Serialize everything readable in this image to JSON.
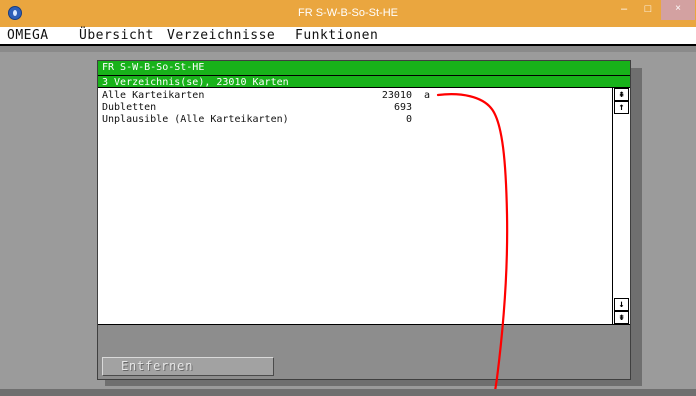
{
  "window": {
    "title": "FR S-W-B-So-St-HE",
    "icon": "app-icon",
    "controls": {
      "minimize": "–",
      "maximize": "□",
      "close": "×"
    },
    "colors": {
      "titlebar": "#eaa63f",
      "close": "#d3a1a1"
    }
  },
  "menu": {
    "items": [
      "OMEGA",
      "Übersicht",
      "Verzeichnisse",
      "Funktionen"
    ]
  },
  "dialog": {
    "title": "FR S-W-B-So-St-HE",
    "subtitle": "3 Verzeichnis(se), 23010 Karten",
    "colors": {
      "header": "#18b21a",
      "panel": "#ffffff",
      "frame": "#8d8d8d"
    },
    "rows": [
      {
        "label": "Alle Karteikarten",
        "value": "23010",
        "flag": "a"
      },
      {
        "label": "Dubletten",
        "value": "693",
        "flag": ""
      },
      {
        "label": "Unplausible (Alle Karteikarten)",
        "value": "0",
        "flag": ""
      }
    ],
    "scrollbar": {
      "top_icon": "double-up-arrow-icon",
      "up_icon": "up-arrow-icon",
      "down_icon": "down-arrow-icon",
      "bottom_icon": "double-down-arrow-icon",
      "top_glyph": "⇞",
      "up_glyph": "↑",
      "down_glyph": "↓",
      "bottom_glyph": "⇟"
    },
    "buttons": {
      "remove": "Entfernen"
    }
  },
  "annotation": {
    "color": "#ff0000",
    "shape": "curved-red-line"
  }
}
